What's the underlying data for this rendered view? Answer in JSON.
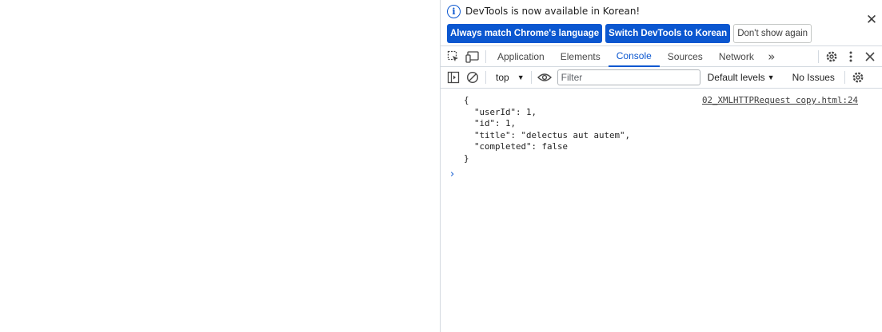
{
  "infobar": {
    "message": "DevTools is now available in Korean!",
    "buttons": {
      "always_match": "Always match Chrome's language",
      "switch": "Switch DevTools to Korean",
      "dont_show": "Don't show again"
    },
    "close_glyph": "✕"
  },
  "tabs": [
    {
      "label": "Application"
    },
    {
      "label": "Elements"
    },
    {
      "label": "Console",
      "active": true
    },
    {
      "label": "Sources"
    },
    {
      "label": "Network"
    }
  ],
  "toolbar": {
    "context": "top",
    "filter_placeholder": "Filter",
    "levels": "Default levels",
    "issues": "No Issues"
  },
  "console": {
    "source_link": "02_XMLHTTPRequest copy.html:24",
    "lines": [
      "{",
      "  \"userId\": 1,",
      "  \"id\": 1,",
      "  \"title\": \"delectus aut autem\",",
      "  \"completed\": false",
      "}"
    ],
    "prompt": "›"
  },
  "colors": {
    "accent": "#0b57d0",
    "border": "#d3d9e0",
    "text": "#1f1f1f"
  }
}
